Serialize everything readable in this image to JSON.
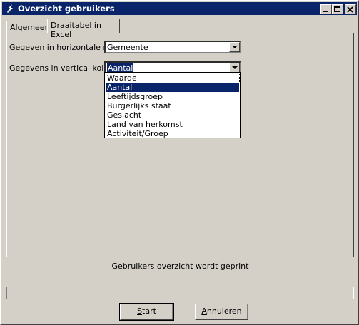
{
  "window": {
    "title": "Overzicht gebruikers"
  },
  "tabs": [
    {
      "label": "Algemeen"
    },
    {
      "label": "Draaitabel in Excel"
    }
  ],
  "form": {
    "horizontal_label": "Gegeven in horizontale rij:",
    "horizontal_value": "Gemeente",
    "vertical_label": "Gegevens in vertical kolom:",
    "vertical_value": "Aantal"
  },
  "dropdown_options": [
    "Waarde",
    "Aantal",
    "Leeftijdsgroep",
    "Burgerlijks staat",
    "Geslacht",
    "Land van herkomst",
    "Activiteit/Groep"
  ],
  "dropdown_selected": "Aantal",
  "status_text": "Gebruikers overzicht wordt geprint",
  "progress": 0,
  "buttons": {
    "start_rest": "tart",
    "start_accel": "S",
    "cancel_rest": "nnuleren",
    "cancel_accel": "A"
  },
  "colors": {
    "titlebar": "#0a246a",
    "face": "#d4d0c8",
    "selection": "#0a246a"
  }
}
